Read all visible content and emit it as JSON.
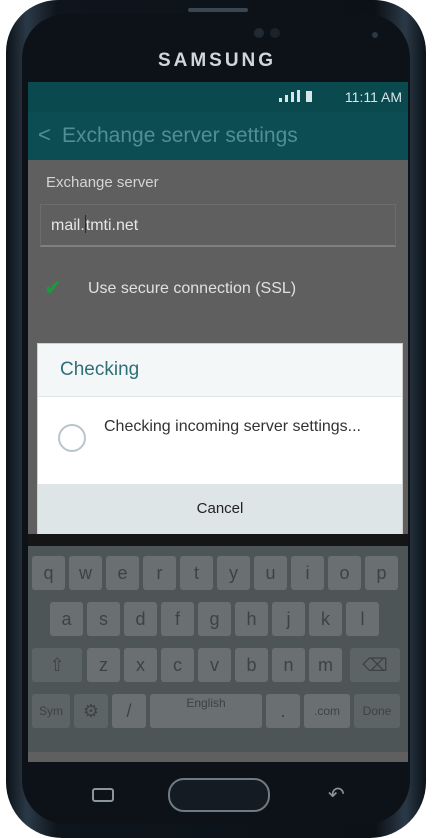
{
  "device": {
    "brand": "SAMSUNG"
  },
  "status_bar": {
    "time": "11:11 AM"
  },
  "app_bar": {
    "back_glyph": "<",
    "title": "Exchange server settings"
  },
  "form": {
    "server_label": "Exchange server",
    "server_value_prefix": "mail.",
    "server_value_suffix": "tmti.net",
    "ssl_checked": true,
    "ssl_label": "Use secure connection (SSL)"
  },
  "dialog": {
    "title": "Checking",
    "message": "Checking incoming server settings...",
    "cancel_label": "Cancel"
  },
  "keyboard": {
    "row1": [
      "q",
      "w",
      "e",
      "r",
      "t",
      "y",
      "u",
      "i",
      "o",
      "p"
    ],
    "row2": [
      "a",
      "s",
      "d",
      "f",
      "g",
      "h",
      "j",
      "k",
      "l"
    ],
    "row3": [
      "z",
      "x",
      "c",
      "v",
      "b",
      "n",
      "m"
    ],
    "row4": {
      "sym": "Sym",
      "slash": "/",
      "space_label": "English",
      "dot": ".",
      "com": ".com",
      "done": "Done"
    }
  },
  "colors": {
    "status_bar": "#0a4a4f",
    "app_bar": "#0c4d53",
    "dialog_title": "#2f6f78",
    "checkbox": "#1a9a3a"
  },
  "icons": [
    "signal-icon",
    "battery-icon",
    "back-arrow-icon",
    "checkmark-icon",
    "spinner-icon",
    "shift-icon",
    "backspace-icon",
    "settings-gear-icon",
    "recent-apps-icon",
    "home-button-icon",
    "back-nav-icon"
  ]
}
